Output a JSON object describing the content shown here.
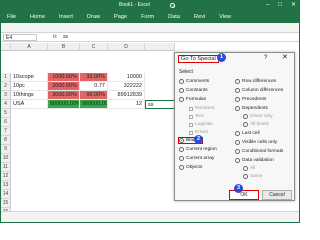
{
  "titlebar": {
    "title": "Book1 - Excel"
  },
  "ribbon": {
    "tabs": [
      "File",
      "Home",
      "Insert",
      "Draw",
      "Page",
      "Form",
      "Data",
      "Revi",
      "View"
    ]
  },
  "formula_bar": {
    "name_box": "E4",
    "fx": "fx",
    "value": "ss"
  },
  "grid": {
    "columns": [
      "A",
      "B",
      "C",
      "D"
    ],
    "rows": [
      "1",
      "2",
      "3",
      "4",
      "5",
      "6",
      "7",
      "8",
      "9",
      "10",
      "11",
      "12",
      "13",
      "14",
      "15",
      "16",
      "17",
      "18",
      "19"
    ],
    "cells": [
      [
        "10scope",
        "1000.00%",
        "33.00%",
        "10000"
      ],
      [
        "10pc",
        "2000.00%",
        "0.77",
        "322222"
      ],
      [
        "10things",
        "3000.00%",
        "99.00%",
        "89912839"
      ],
      [
        "USA",
        "800000.00%",
        "900000.00%",
        "12"
      ]
    ],
    "selected_cell_value": "ss"
  },
  "dialog": {
    "title": "Go To Special",
    "help": "?",
    "close": "✕",
    "select_label": "Select",
    "left_options": [
      "Comments",
      "Constants",
      "Formulas"
    ],
    "formula_sub": [
      "Numbers",
      "Text",
      "Logicals",
      "Errors"
    ],
    "blanks_label": "Blanks",
    "left_options2": [
      "Current region",
      "Current array",
      "Objects"
    ],
    "right_options": [
      "Row differences",
      "Column differences",
      "Precedents",
      "Dependents"
    ],
    "dependents_sub": [
      "Direct only",
      "All levels"
    ],
    "right_options2": [
      "Last cell",
      "Visible cells only",
      "Conditional formats",
      "Data validation"
    ],
    "validation_sub": [
      "All",
      "Same"
    ],
    "ok_label": "OK",
    "cancel_label": "Cancel"
  },
  "badges": [
    "1",
    "2",
    "3"
  ],
  "colors": {
    "excel_green": "#217346",
    "highlight_red": "#e00000",
    "badge_blue": "#2b4bd6"
  }
}
